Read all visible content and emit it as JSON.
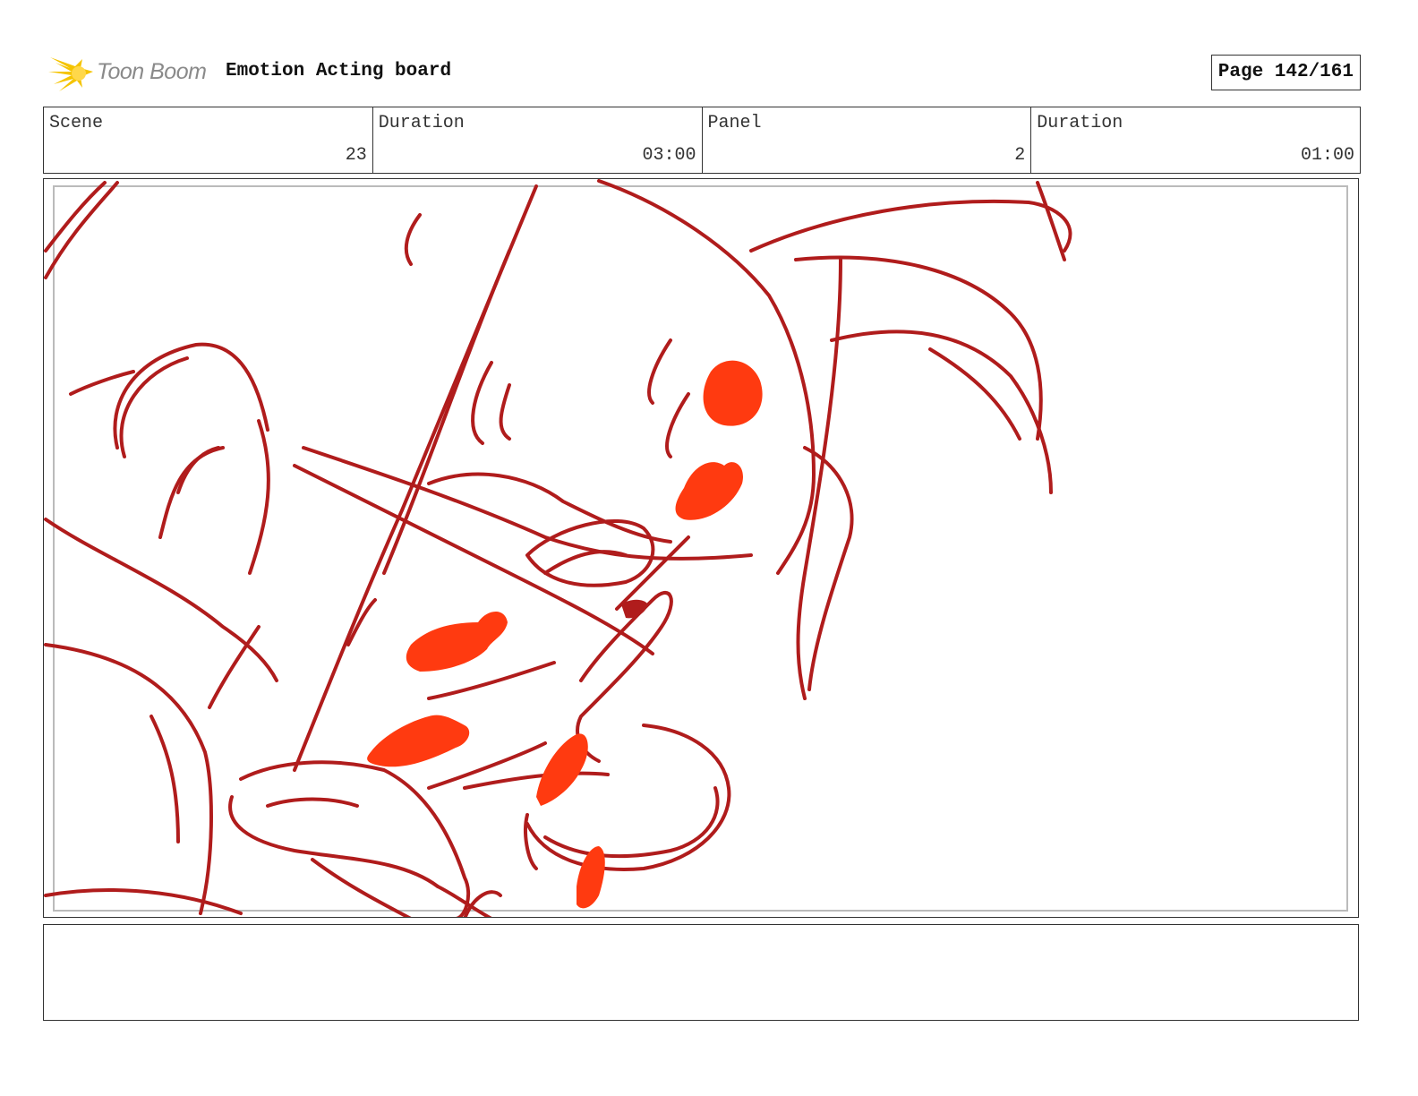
{
  "header": {
    "logo_text": "Toon Boom",
    "board_title": "Emotion Acting board",
    "page_label": "Page 142/161"
  },
  "info": {
    "scene_label": "Scene",
    "scene_value": "23",
    "scene_duration_label": "Duration",
    "scene_duration_value": "03:00",
    "panel_label": "Panel",
    "panel_value": "2",
    "panel_duration_label": "Duration",
    "panel_duration_value": "01:00"
  },
  "colors": {
    "sketch_line": "#b01c1c",
    "sketch_fill": "#ff3a10",
    "logo_yellow": "#f5c400"
  },
  "notes": {
    "text": ""
  }
}
